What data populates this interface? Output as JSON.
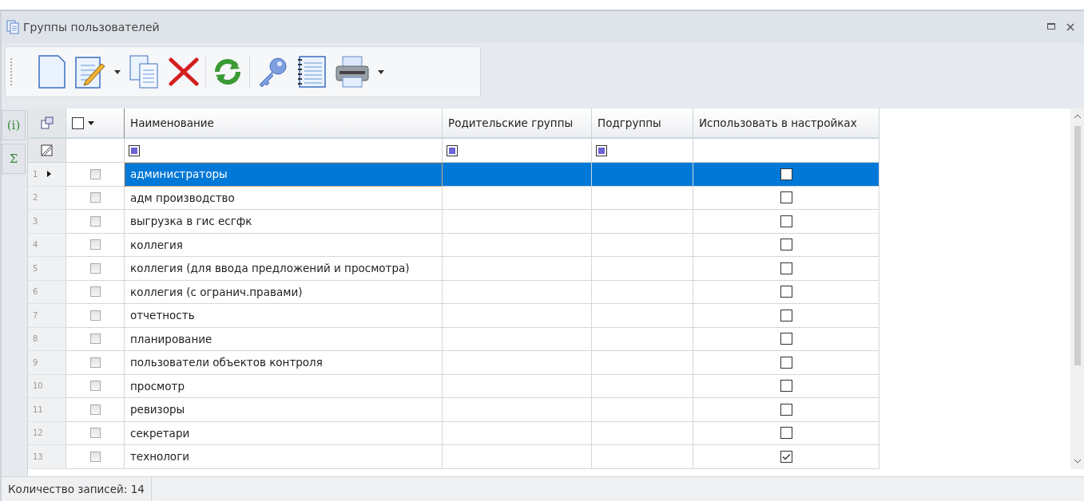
{
  "window": {
    "title": "Группы пользователей"
  },
  "side_tabs": [
    {
      "label": "(i)",
      "selected": false
    },
    {
      "label": "Σ",
      "selected": false
    }
  ],
  "table": {
    "columns": [
      "Наименование",
      "Родительские группы",
      "Подгруппы",
      "Использовать в настройках"
    ],
    "select_all": {
      "checked": false
    },
    "rows": [
      {
        "number": "1",
        "name": "администраторы",
        "selected": true,
        "checked": false,
        "use_in_settings": false
      },
      {
        "number": "2",
        "name": "адм производство",
        "selected": false,
        "checked": false,
        "use_in_settings": false
      },
      {
        "number": "3",
        "name": "выгрузка в гис есгфк",
        "selected": false,
        "checked": false,
        "use_in_settings": false
      },
      {
        "number": "4",
        "name": "коллегия",
        "selected": false,
        "checked": false,
        "use_in_settings": false
      },
      {
        "number": "5",
        "name": "коллегия (для ввода предложений и просмотра)",
        "selected": false,
        "checked": false,
        "use_in_settings": false
      },
      {
        "number": "6",
        "name": "коллегия (с огранич.правами)",
        "selected": false,
        "checked": false,
        "use_in_settings": false
      },
      {
        "number": "7",
        "name": "отчетность",
        "selected": false,
        "checked": false,
        "use_in_settings": false
      },
      {
        "number": "8",
        "name": "планирование",
        "selected": false,
        "checked": false,
        "use_in_settings": false
      },
      {
        "number": "9",
        "name": "пользователи объектов контроля",
        "selected": false,
        "checked": false,
        "use_in_settings": false
      },
      {
        "number": "10",
        "name": "просмотр",
        "selected": false,
        "checked": false,
        "use_in_settings": false
      },
      {
        "number": "11",
        "name": "ревизоры",
        "selected": false,
        "checked": false,
        "use_in_settings": false
      },
      {
        "number": "12",
        "name": "секретари",
        "selected": false,
        "checked": false,
        "use_in_settings": false
      },
      {
        "number": "13",
        "name": "технологи",
        "selected": false,
        "checked": false,
        "use_in_settings": true
      }
    ]
  },
  "status_bar": {
    "text": "Количество записей: 14"
  }
}
